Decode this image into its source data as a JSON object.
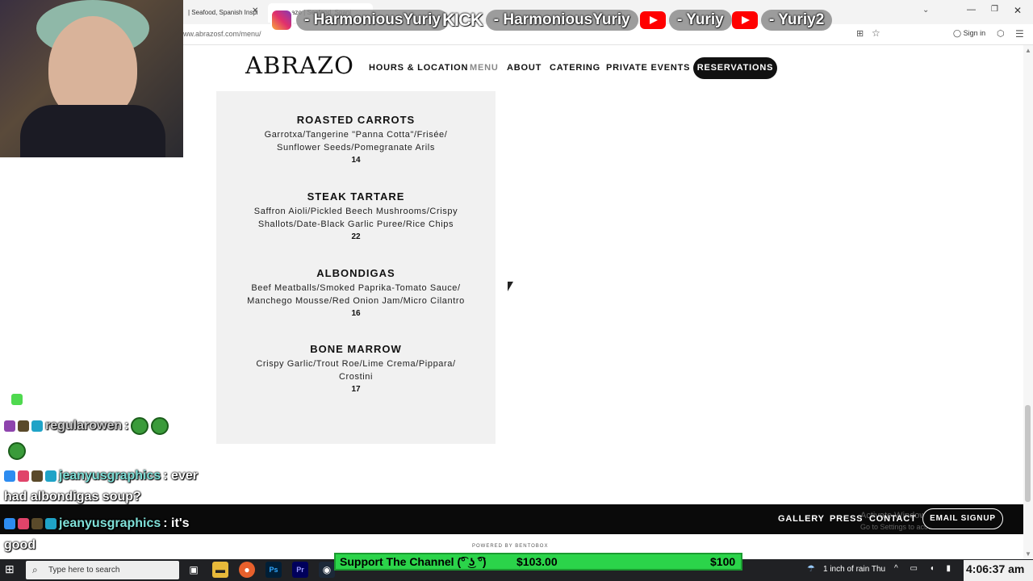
{
  "browser": {
    "tabs": [
      {
        "label": "| Seafood, Spanish Inspi"
      },
      {
        "label": "u | Abrazo | Seafood, Spani"
      }
    ],
    "url": "ww.abrazosf.com/menu/",
    "sign_in": "Sign in"
  },
  "social": {
    "instagram": "- HarmoniousYuriy",
    "kick_logo": "KICK",
    "kick": "- HarmoniousYuriy",
    "youtube1": "- Yuriy",
    "youtube2": "- Yuriy2"
  },
  "site": {
    "logo": "ABRAZO",
    "nav": {
      "hours": "HOURS & LOCATION",
      "menu": "MENU",
      "about": "ABOUT",
      "catering": "CATERING",
      "private_events": "PRIVATE EVENTS",
      "reservations": "RESERVATIONS"
    },
    "menu_items": [
      {
        "name": "ROASTED CARROTS",
        "desc1": "Garrotxa/Tangerine \"Panna Cotta\"/Frisée/",
        "desc2": "Sunflower Seeds/Pomegranate Arils",
        "price": "14"
      },
      {
        "name": "STEAK TARTARE",
        "desc1": "Saffron Aioli/Pickled Beech Mushrooms/Crispy",
        "desc2": "Shallots/Date-Black Garlic Puree/Rice Chips",
        "price": "22"
      },
      {
        "name": "ALBONDIGAS",
        "desc1": "Beef Meatballs/Smoked Paprika-Tomato Sauce/",
        "desc2": "Manchego Mousse/Red Onion Jam/Micro Cilantro",
        "price": "16"
      },
      {
        "name": "BONE MARROW",
        "desc1": "Crispy Garlic/Trout Roe/Lime Crema/Pippara/",
        "desc2": "Crostini",
        "price": "17"
      }
    ],
    "footer": {
      "gallery": "GALLERY",
      "press": "PRESS",
      "contact": "CONTACT",
      "email_signup": "EMAIL SIGNUP",
      "powered_by": "POWERED BY BENTOBOX"
    }
  },
  "windows_watermark": {
    "line1": "Activate Windows",
    "line2": "Go to Settings to activate Windows."
  },
  "chat": [
    {
      "user": "regularowen",
      "message": ":"
    },
    {
      "user": "jeanyusgraphics",
      "message": ": ever",
      "cont": "had albondigas soup?"
    },
    {
      "user": "jeanyusgraphics",
      "message": ": it's",
      "cont": "good"
    }
  ],
  "goal": {
    "title": "Support The Channel (͡° ͜ʖ ͡°)",
    "current": "$103.00",
    "target": "$100"
  },
  "taskbar": {
    "search_placeholder": "Type here to search",
    "weather": "1 inch of rain Thu",
    "clock": "4:06:37 am"
  }
}
